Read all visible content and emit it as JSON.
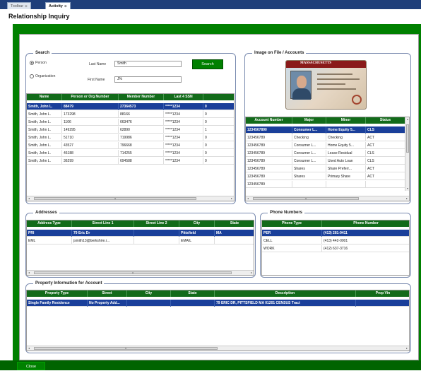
{
  "tabs": [
    {
      "label": "Toolbar",
      "active": false
    },
    {
      "label": "Activity",
      "active": true
    }
  ],
  "page_title": "Relationship Inquiry",
  "search": {
    "legend": "Search",
    "radio_person": "Person",
    "radio_org": "Organization",
    "last_name_label": "Last Name",
    "last_name_value": "Smith",
    "first_name_label": "First Name",
    "first_name_value": "J%",
    "search_button": "Search",
    "columns": [
      "Name",
      "Person or Org Number",
      "Member Number",
      "Last 4 SSN",
      ""
    ],
    "rows": [
      [
        "Smith, John L.",
        "88479",
        "27364573",
        "*****1234",
        "0"
      ],
      [
        "Smith, John L.",
        "173298",
        "88166",
        "*****1234",
        "0"
      ],
      [
        "Smith, John L.",
        "1106",
        "663476",
        "*****1234",
        "0"
      ],
      [
        "Smith, John L.",
        "149295",
        "62890",
        "*****1234",
        "1"
      ],
      [
        "Smith, John L.",
        "51710",
        "719986",
        "*****1234",
        "0"
      ],
      [
        "Smith, John L.",
        "43527",
        "796668",
        "*****1234",
        "0"
      ],
      [
        "Smith, John L.",
        "46188",
        "714255",
        "*****1234",
        "0"
      ],
      [
        "Smith, John L.",
        "36299",
        "694588",
        "*****1234",
        "0"
      ]
    ],
    "selected_row": 0
  },
  "image_panel": {
    "legend": "Image on File / Accounts",
    "card_state": "MASSACHUSETTS",
    "columns": [
      "Account Number",
      "Major",
      "Minor",
      "Status"
    ],
    "rows": [
      [
        "1234567890",
        "Consumer L...",
        "Home Equity 5...",
        "CLS"
      ],
      [
        "123456789",
        "Checking",
        "Checking",
        "ACT"
      ],
      [
        "123456789",
        "Consumer L...",
        "Home Equity 5...",
        "ACT"
      ],
      [
        "123456789",
        "Consumer L...",
        "Lease Residual",
        "CLS"
      ],
      [
        "123456789",
        "Consumer L...",
        "Used Auto Loan",
        "CLS"
      ],
      [
        "123456789",
        "Shares",
        "Share Preferr...",
        "ACT"
      ],
      [
        "123456789",
        "Shares",
        "Primary Share",
        "ACT"
      ],
      [
        "123456789",
        "",
        "",
        ""
      ]
    ],
    "selected_row": 0
  },
  "addresses": {
    "legend": "Addresses",
    "columns": [
      "Address Type",
      "Street Line 1",
      "Street Line 2",
      "City",
      "State"
    ],
    "rows": [
      [
        "PRI",
        "79 Eric Dr",
        "",
        "Pittsfield",
        "MA"
      ],
      [
        "EML",
        "jsmith13@berkshire.r...",
        "",
        "EMAIL",
        ""
      ]
    ],
    "selected_row": 0
  },
  "phones": {
    "legend": "Phone Numbers",
    "columns": [
      "Phone Type",
      "Phone Number"
    ],
    "rows": [
      [
        "PER",
        "(413) 281-9411"
      ],
      [
        "CELL",
        "(413) 442-0001"
      ],
      [
        "WORK",
        "(412) 637-3716"
      ]
    ],
    "selected_row": 0
  },
  "property": {
    "legend": "Property Information for Account",
    "columns": [
      "Property Type",
      "Street",
      "City",
      "State",
      "Description",
      "Prop Vin"
    ],
    "rows": [
      [
        "Single Family Residence",
        "No Property Add...",
        "",
        "",
        "79 ERIC DR, PITTSFIELD     MA 01201 CENSUS Tract",
        ""
      ]
    ],
    "selected_row": 0
  },
  "close_button": "Close",
  "colors": {
    "tab_bar": "#1f3f7a",
    "frame_green": "#008000",
    "header_green": "#126b1a",
    "selection_blue": "#1a3f9a"
  }
}
